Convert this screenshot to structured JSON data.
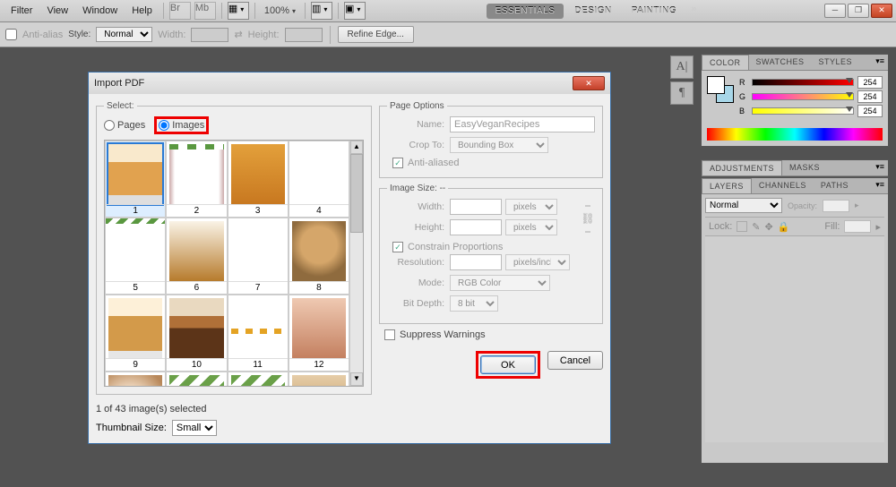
{
  "menubar": {
    "items": [
      "Filter",
      "View",
      "Window",
      "Help"
    ],
    "zoom": "100%"
  },
  "workspaces": {
    "tabs": [
      "ESSENTIALS",
      "DESIGN",
      "PAINTING"
    ],
    "active": 0,
    "arrow": "»"
  },
  "optionsbar": {
    "antialias": "Anti-alias",
    "style_label": "Style:",
    "style_value": "Normal",
    "width_label": "Width:",
    "height_label": "Height:",
    "refine": "Refine Edge..."
  },
  "dialog": {
    "title": "Import PDF",
    "select_legend": "Select:",
    "radio_pages": "Pages",
    "radio_images": "Images",
    "status": "1 of 43 image(s) selected",
    "thumb_label": "Thumbnail Size:",
    "thumb_value": "Small",
    "thumbs": [
      1,
      2,
      3,
      4,
      5,
      6,
      7,
      8,
      9,
      10,
      11,
      12
    ],
    "page_options": {
      "legend": "Page Options",
      "name_label": "Name:",
      "name_value": "EasyVeganRecipes",
      "crop_label": "Crop To:",
      "crop_value": "Bounding Box",
      "antialiased": "Anti-aliased"
    },
    "image_size": {
      "legend": "Image Size: --",
      "width_label": "Width:",
      "height_label": "Height:",
      "unit": "pixels",
      "constrain": "Constrain Proportions",
      "resolution_label": "Resolution:",
      "resolution_unit": "pixels/inch",
      "mode_label": "Mode:",
      "mode_value": "RGB Color",
      "bitdepth_label": "Bit Depth:",
      "bitdepth_value": "8 bit"
    },
    "suppress": "Suppress Warnings",
    "ok": "OK",
    "cancel": "Cancel"
  },
  "color_panel": {
    "tabs": [
      "COLOR",
      "SWATCHES",
      "STYLES"
    ],
    "channels": [
      "R",
      "G",
      "B"
    ],
    "values": [
      "254",
      "254",
      "254"
    ]
  },
  "adjust_panel": {
    "tabs": [
      "ADJUSTMENTS",
      "MASKS"
    ]
  },
  "layers_panel": {
    "tabs": [
      "LAYERS",
      "CHANNELS",
      "PATHS"
    ],
    "blend": "Normal",
    "opacity_label": "Opacity:",
    "lock_label": "Lock:",
    "fill_label": "Fill:"
  },
  "left_icons": [
    "A|",
    "¶"
  ]
}
